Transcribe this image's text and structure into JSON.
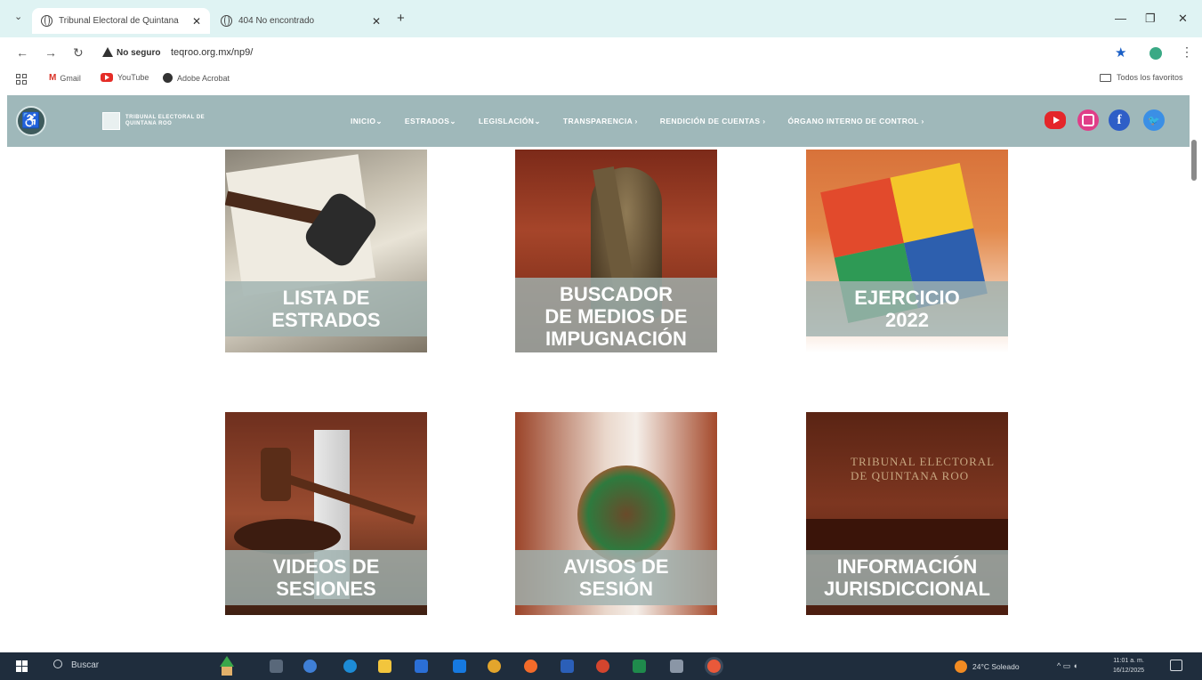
{
  "browser": {
    "tabs": [
      {
        "title": "Tribunal Electoral de Quintana",
        "active": true
      },
      {
        "title": "404 No encontrado",
        "active": false
      }
    ],
    "security_label": "No seguro",
    "url": "teqroo.org.mx/np9/",
    "bookmarks": [
      {
        "label": "Gmail",
        "icon": "gmail-icon"
      },
      {
        "label": "YouTube",
        "icon": "youtube-icon"
      },
      {
        "label": "Adobe Acrobat",
        "icon": "globe-icon"
      }
    ],
    "favorites_label": "Todos los favoritos"
  },
  "site": {
    "logo_text": "TRIBUNAL ELECTORAL DE QUINTANA ROO",
    "nav": [
      "INICIO⌄",
      "ESTRADOS⌄",
      "LEGISLACIÓN⌄",
      "TRANSPARENCIA ›",
      "RENDICIÓN DE CUENTAS ›",
      "ÓRGANO INTERNO DE CONTROL ›"
    ],
    "social": [
      "youtube",
      "instagram",
      "facebook",
      "twitter"
    ],
    "header_color": "#9fb8ba"
  },
  "tiles": [
    {
      "label_line1": "LISTA DE",
      "label_line2": "ESTRADOS",
      "label_line3": ""
    },
    {
      "label_line1": "BUSCADOR",
      "label_line2": "DE MEDIOS DE",
      "label_line3": "IMPUGNACIÓN"
    },
    {
      "label_line1": "EJERCICIO",
      "label_line2": "2022",
      "label_line3": ""
    },
    {
      "label_line1": "VIDEOS DE",
      "label_line2": "SESIONES",
      "label_line3": ""
    },
    {
      "label_line1": "AVISOS DE",
      "label_line2": "SESIÓN",
      "label_line3": ""
    },
    {
      "label_line1": "INFORMACIÓN",
      "label_line2": "JURISDICCIONAL",
      "label_line3": ""
    }
  ],
  "tile_wall_text": "TRIBUNAL ELECTORAL DE QUINTANA ROO",
  "taskbar": {
    "search_label": "Buscar",
    "weather": "24°C Soleado",
    "time": "11:01 a. m.",
    "date": "16/12/2025"
  }
}
